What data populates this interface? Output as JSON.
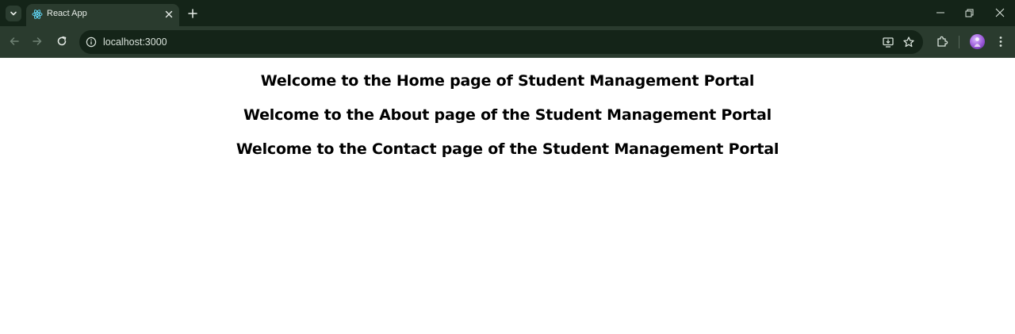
{
  "tab": {
    "title": "React App",
    "favicon": "react-icon"
  },
  "address_bar": {
    "url": "localhost:3000"
  },
  "icons": {
    "tab_search": "chevron-down-icon",
    "tab_close": "close-icon",
    "new_tab": "plus-icon",
    "back": "arrow-left-icon",
    "forward": "arrow-right-icon",
    "reload": "reload-icon",
    "site_info": "info-icon",
    "install": "install-app-icon",
    "bookmark": "star-icon",
    "extensions": "puzzle-icon",
    "profile": "avatar",
    "menu": "kebab-menu-icon",
    "minimize": "minimize-icon",
    "restore": "restore-icon",
    "close_window": "close-icon"
  },
  "colors": {
    "tabstrip": "#142418",
    "toolbar": "#2a3b2e",
    "page_background": "#ffffff",
    "heading_text": "#000000",
    "react_logo": "#61dafb"
  },
  "page": {
    "headings": [
      "Welcome to the Home page of Student Management Portal",
      "Welcome to the About page of the Student Management Portal",
      "Welcome to the Contact page of the Student Management Portal"
    ]
  }
}
